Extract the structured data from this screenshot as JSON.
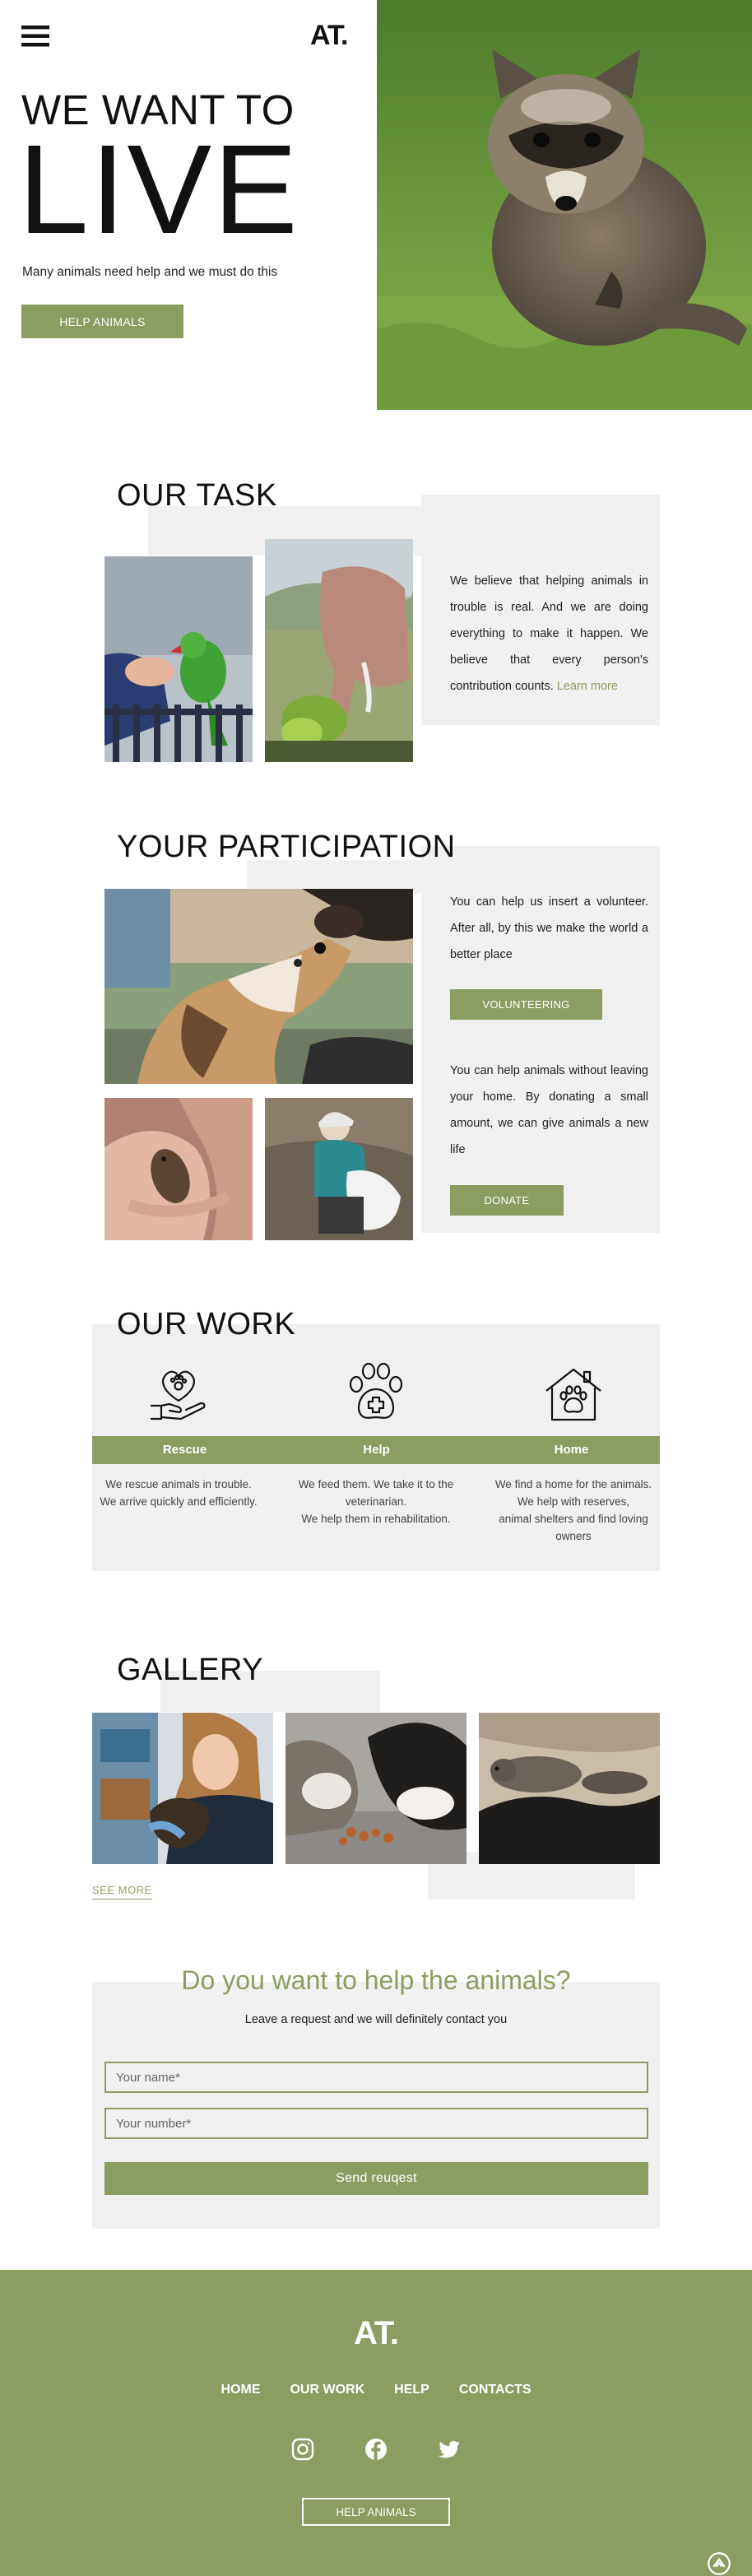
{
  "header": {
    "logo": "AT.",
    "menu_icon": "hamburger-menu-icon"
  },
  "hero": {
    "line1": "WE WANT TO",
    "line2": "LIVE",
    "subtitle": "Many animals need help and we must do this",
    "cta": "HELP ANIMALS"
  },
  "task": {
    "title": "OUR TASK",
    "text": "We believe that helping animals in trouble is real. And we are doing everything to make it happen. We believe that every person's contribution counts.",
    "link": "Learn more"
  },
  "participation": {
    "title": "YOUR PARTICIPATION",
    "text1": "You can help us insert a volunteer. After all, by this we make the world a better place",
    "button1": "VOLUNTEERING",
    "text2": "You can help animals without leaving your home. By donating a small amount, we can give animals a new life",
    "button2": "DONATE"
  },
  "work": {
    "title": "OUR WORK",
    "items": [
      {
        "label": "Rescue",
        "icon": "heart-paw-hand-icon",
        "text": "We rescue animals in trouble.\nWe arrive quickly and efficiently."
      },
      {
        "label": "Help",
        "icon": "paw-medical-cross-icon",
        "text": "We feed them. We take it to the veterinarian.\nWe help them in rehabilitation."
      },
      {
        "label": "Home",
        "icon": "house-paw-icon",
        "text": "We find a home for the animals.\nWe help with reserves,\nanimal shelters and find loving owners"
      }
    ]
  },
  "gallery": {
    "title": "GALLERY",
    "see_more": "SEE MORE"
  },
  "contact": {
    "title": "Do you want to help the animals?",
    "subtitle": "Leave a request and we will definitely contact you",
    "name_placeholder": "Your name*",
    "number_placeholder": "Your number*",
    "submit": "Send reuqest"
  },
  "footer": {
    "logo": "AT.",
    "nav": [
      "HOME",
      "OUR WORK",
      "HELP",
      "CONTACTS"
    ],
    "social": [
      "instagram-icon",
      "facebook-icon",
      "twitter-icon"
    ],
    "cta": "HELP ANIMALS",
    "scroll_top_icon": "scroll-to-top-icon"
  },
  "colors": {
    "accent": "#8b9d60",
    "panel": "#f0f0f0",
    "text": "#111111"
  }
}
